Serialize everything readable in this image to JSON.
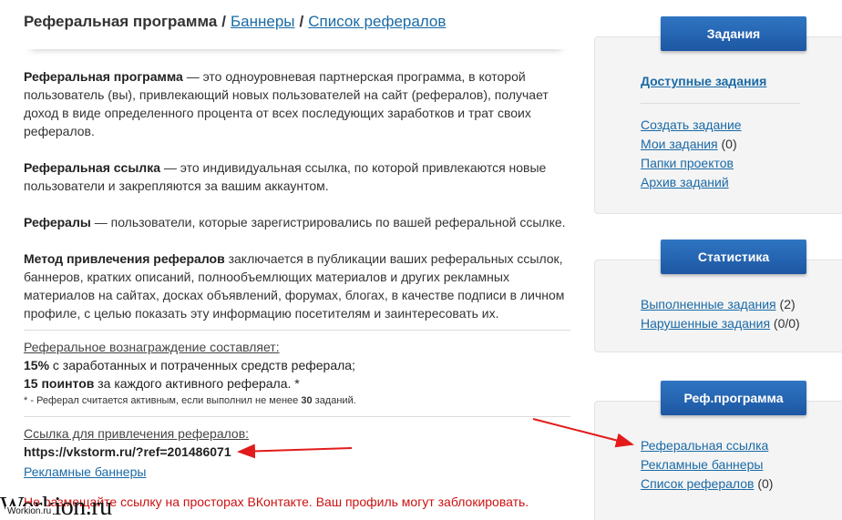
{
  "header": {
    "title": "Реферальная программа",
    "separator": "/",
    "link_banners": "Баннеры",
    "link_referrals": "Список рефералов"
  },
  "definitions": [
    {
      "term": "Реферальная программа",
      "text": " — это одноуровневая партнерская программа, в которой пользователь (вы), привлекающий новых пользователей на сайт (рефералов), получает доход в виде определенного процента от всех последующих заработков и трат своих рефералов."
    },
    {
      "term": "Реферальная ссылка",
      "text": " — это индивидуальная ссылка, по которой привлекаются новые пользователи и закрепляются за вашим аккаунтом."
    },
    {
      "term": "Рефералы",
      "text": " — пользователи, которые зарегистрировались по вашей реферальной ссылке."
    },
    {
      "term": "Метод привлечения рефералов",
      "text": " заключается в публикации ваших реферальных ссылок, баннеров, кратких описаний, полнообъемлющих материалов и других рекламных материалов на сайтах, досках объявлений, форумах, блогах, в качестве подписи в личном профиле, с целью показать эту информацию посетителям и заинтересовать их."
    }
  ],
  "reward": {
    "label": "Реферальное вознаграждение составляет:",
    "line1_bold": "15%",
    "line1_text": " с заработанных и потраченных средств реферала;",
    "line2_bold": "15 поинтов",
    "line2_text": " за каждого активного реферала. *",
    "note_prefix": "* - Реферал считается активным, если выполнил не менее ",
    "note_bold": "30",
    "note_suffix": " заданий."
  },
  "ref_link": {
    "label": "Ссылка для привлечения рефералов:",
    "url": "https://vkstorm.ru/?ref=201486071",
    "banners_link": "Рекламные баннеры"
  },
  "warning": "Не размещайте ссылку на просторах ВКонтакте. Ваш профиль могут заблокировать.",
  "sidebar": {
    "tasks": {
      "tab": "Задания",
      "available": "Доступные задания",
      "items": [
        {
          "label": "Создать задание",
          "count": ""
        },
        {
          "label": "Мои задания",
          "count": " (0)"
        },
        {
          "label": "Папки проектов",
          "count": ""
        },
        {
          "label": "Архив заданий",
          "count": ""
        }
      ]
    },
    "stats": {
      "tab": "Статистика",
      "items": [
        {
          "label": "Выполненные задания",
          "count": " (2)"
        },
        {
          "label": "Нарушенные задания",
          "count": " (0/0)"
        }
      ]
    },
    "ref": {
      "tab": "Реф.программа",
      "items": [
        {
          "label": "Реферальная ссылка",
          "count": ""
        },
        {
          "label": "Рекламные баннеры",
          "count": ""
        },
        {
          "label": "Список рефералов",
          "count": " (0)"
        }
      ]
    }
  },
  "watermark": {
    "big": "Workion.ru",
    "small": "Workion.ru"
  },
  "colors": {
    "link": "#1a6aa6",
    "tab": "#2666b3",
    "arrow": "#e31b1b",
    "warning": "#cc1111"
  }
}
